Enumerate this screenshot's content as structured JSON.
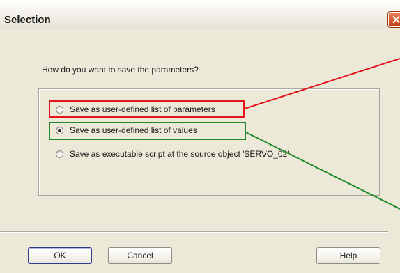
{
  "window": {
    "title": "Selection"
  },
  "question": "How do you want to save the parameters?",
  "options": [
    {
      "label": "Save as user-defined list of parameters",
      "selected": false
    },
    {
      "label": "Save as user-defined list of values",
      "selected": true
    },
    {
      "label": "Save as executable script at the source object 'SERVO_02'",
      "selected": false
    }
  ],
  "buttons": {
    "ok": "OK",
    "cancel": "Cancel",
    "help": "Help"
  },
  "annotations": {
    "red": "#e3121b",
    "green": "#1f8a2a"
  }
}
